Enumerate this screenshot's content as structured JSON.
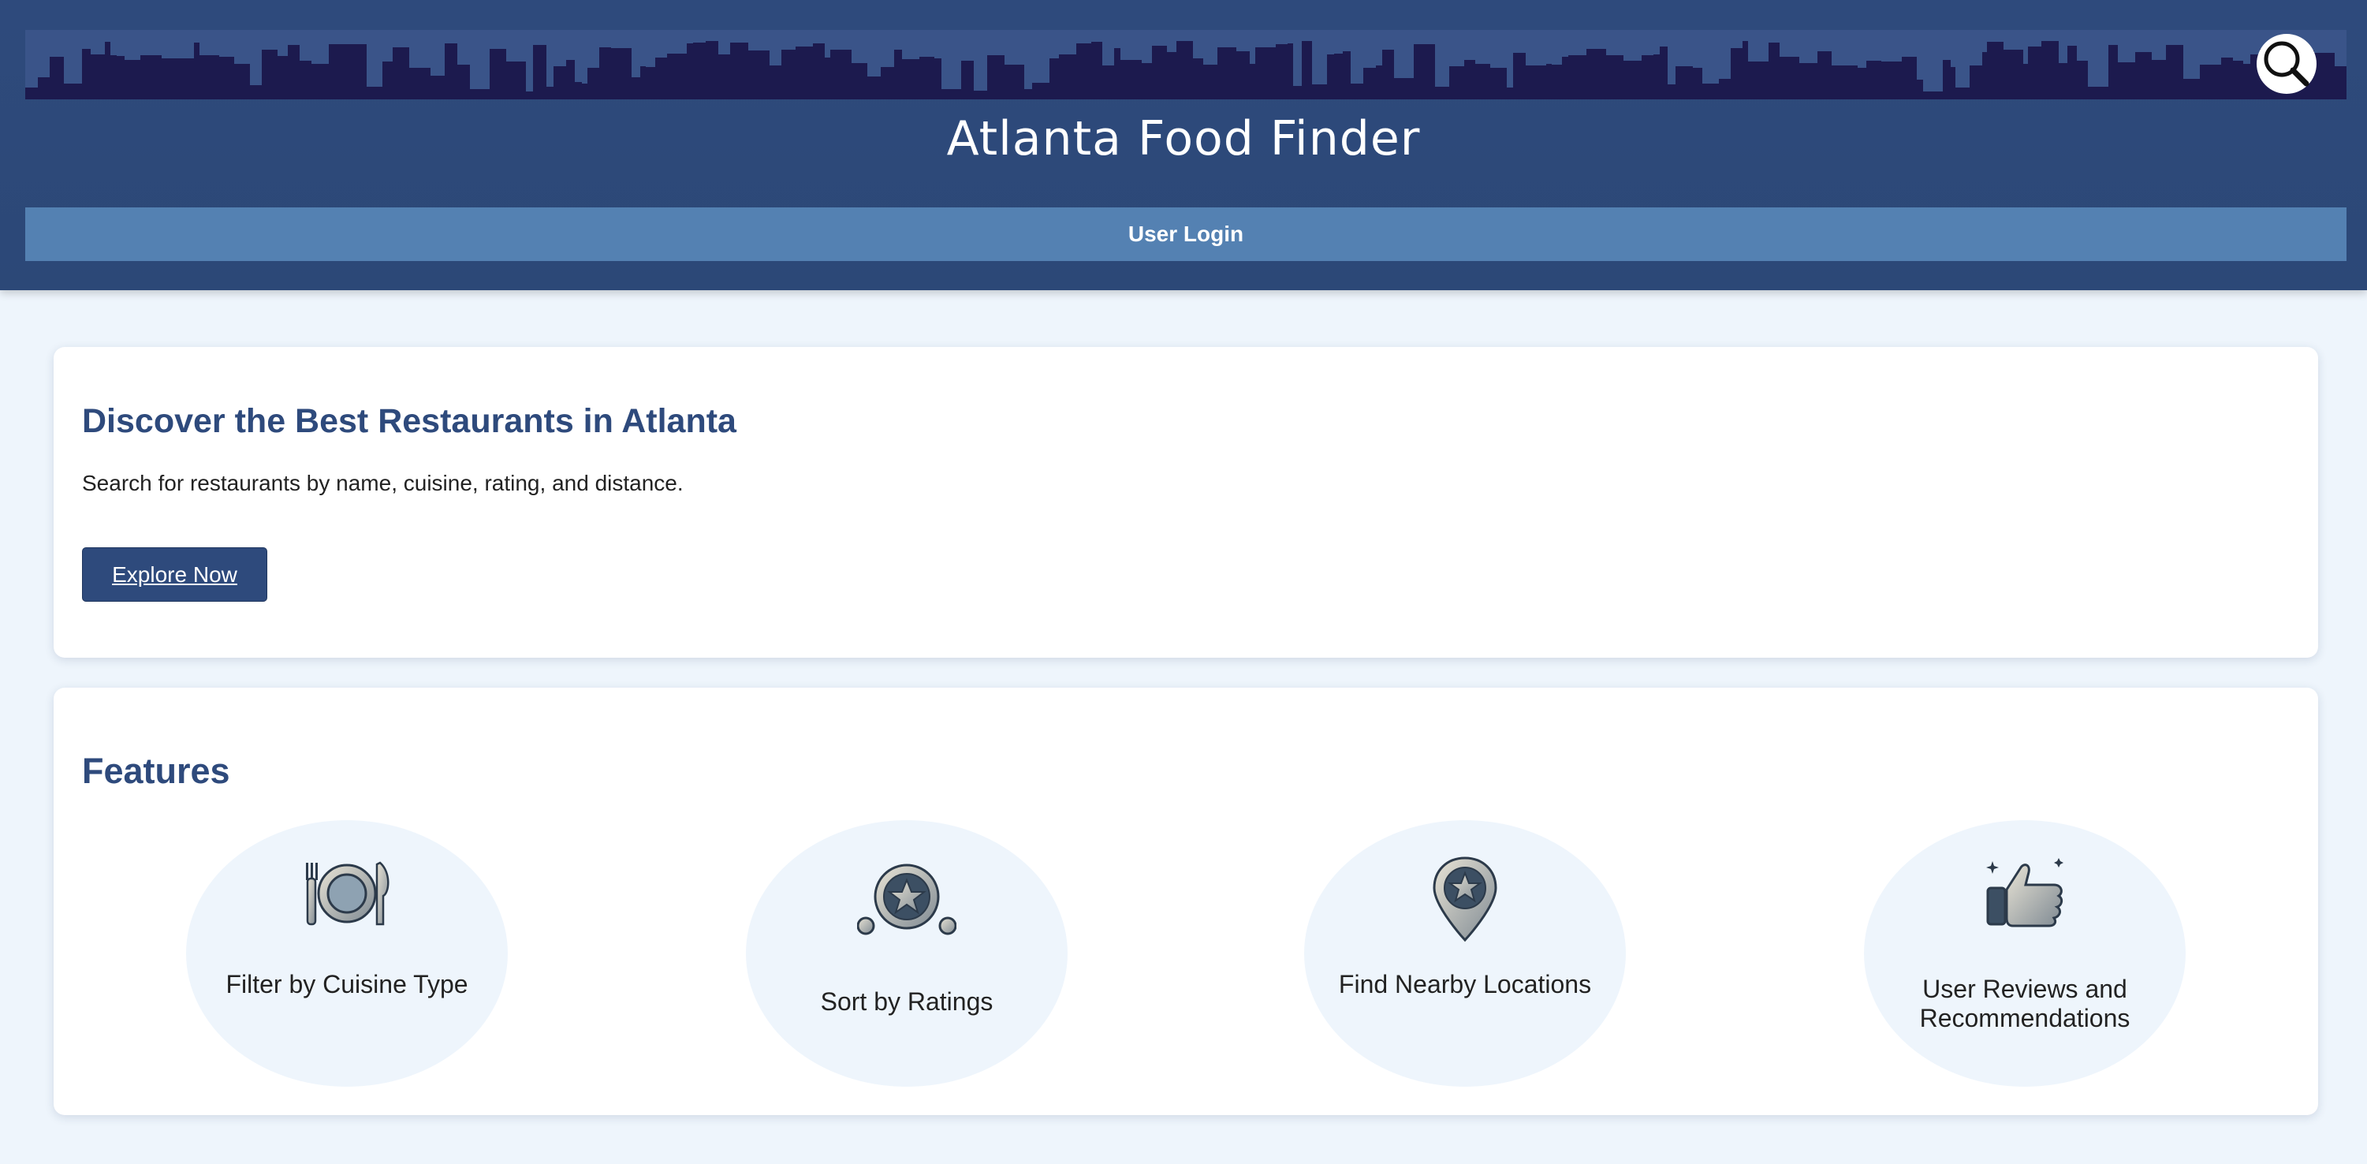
{
  "header": {
    "title": "Atlanta Food Finder",
    "login_label": "User Login",
    "search_icon": "magnifier-icon"
  },
  "hero": {
    "title": "Discover the Best Restaurants in Atlanta",
    "description": "Search for restaurants by name, cuisine, rating, and distance.",
    "button_label": "Explore Now"
  },
  "features": {
    "title": "Features",
    "items": [
      {
        "label": "Filter by Cuisine Type",
        "icon": "plate-cutlery-icon"
      },
      {
        "label": "Sort by Ratings",
        "icon": "star-medal-icon"
      },
      {
        "label": "Find Nearby Locations",
        "icon": "map-pin-icon"
      },
      {
        "label": "User Reviews and Recommendations",
        "icon": "thumbs-up-icon"
      }
    ]
  },
  "colors": {
    "header_bg": "#2e4a7c",
    "login_bar": "#5481b2",
    "accent_text": "#2e4a7c",
    "page_bg": "#eef5fc"
  }
}
